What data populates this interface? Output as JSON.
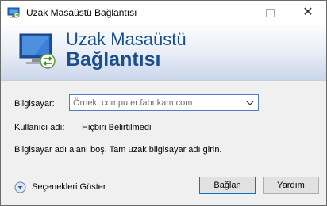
{
  "window": {
    "title": "Uzak Masaüstü Bağlantısı",
    "close_symbol": "✕"
  },
  "banner": {
    "line1": "Uzak Masaüstü",
    "line2": "Bağlantısı"
  },
  "form": {
    "computer_label": "Bilgisayar:",
    "computer_placeholder": "Örnek: computer.fabrikam.com",
    "user_label": "Kullanıcı adı:",
    "user_value": "Hiçbiri Belirtilmedi",
    "info": "Bilgisayar adı alanı boş. Tam uzak bilgisayar adı girin."
  },
  "footer": {
    "options_label": "Seçenekleri Göster",
    "connect_label": "Bağlan",
    "help_label": "Yardım"
  },
  "colors": {
    "banner_text": "#1b4f8c",
    "focus_border": "#0078d7"
  },
  "icons": {
    "app": "remote-desktop-icon",
    "banner": "remote-monitor-icon",
    "dropdown": "chevron-down-icon",
    "options": "expand-circle-icon"
  }
}
